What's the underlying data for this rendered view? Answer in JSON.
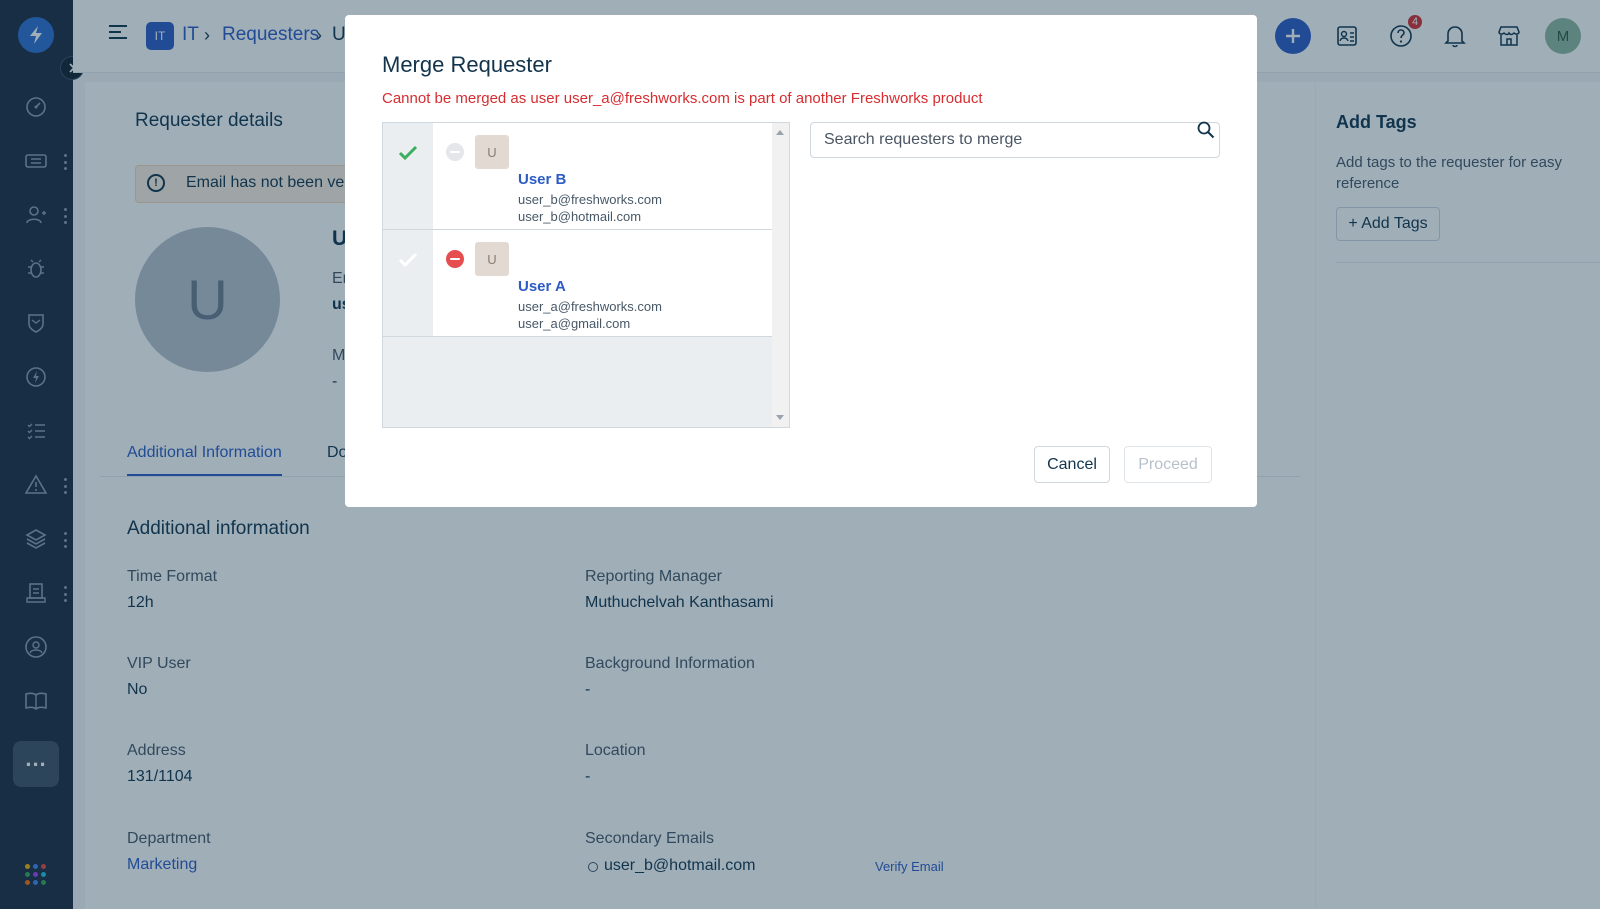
{
  "nav": {
    "items": [
      "dashboard-icon",
      "tickets-icon",
      "requesters-icon",
      "problems-icon",
      "changes-icon",
      "releases-icon",
      "tasks-icon",
      "alerts-icon",
      "assets-icon",
      "reports-icon",
      "admin-icon",
      "solutions-icon"
    ],
    "more_label": "..."
  },
  "header": {
    "workspace_badge": "IT",
    "breadcrumb": [
      "IT",
      "Requesters",
      "U"
    ],
    "notifications_count": "4",
    "user_avatar": "M",
    "accent": "#2c5cc5"
  },
  "requester": {
    "section_title": "Requester details",
    "email_warning": "Email has not been verified",
    "avatar_letter": "U",
    "name_fragment": "Us",
    "email_label_fragment": "Em",
    "email_value_fragment": "use",
    "mobile_label_fragment": "Mo",
    "mobile_value": "-"
  },
  "tabs": [
    "Additional Information",
    "Doc"
  ],
  "additional": {
    "title": "Additional information",
    "time_format": {
      "label": "Time Format",
      "value": "12h"
    },
    "reporting_manager": {
      "label": "Reporting Manager",
      "value": "Muthuchelvah Kanthasami"
    },
    "vip_user": {
      "label": "VIP User",
      "value": "No"
    },
    "background": {
      "label": "Background Information",
      "value": "-"
    },
    "address": {
      "label": "Address",
      "value": "131/1104"
    },
    "location": {
      "label": "Location",
      "value": "-"
    },
    "department": {
      "label": "Department",
      "value": "Marketing"
    },
    "secondary_emails": {
      "label": "Secondary Emails",
      "value": "user_b@hotmail.com",
      "verify": "Verify Email"
    }
  },
  "tags": {
    "title": "Add Tags",
    "description": "Add tags to the requester for easy reference",
    "button": "+ Add Tags"
  },
  "modal": {
    "title": "Merge Requester",
    "error": "Cannot be merged as user user_a@freshworks.com is part of another Freshworks product",
    "search_placeholder": "Search requesters to merge",
    "cancel": "Cancel",
    "proceed": "Proceed",
    "users": [
      {
        "avatar": "U",
        "name": "User B",
        "email1": "user_b@freshworks.com",
        "email2": "user_b@hotmail.com",
        "primary": true
      },
      {
        "avatar": "U",
        "name": "User A",
        "email1": "user_a@freshworks.com",
        "email2": "user_a@gmail.com",
        "primary": false
      }
    ]
  }
}
